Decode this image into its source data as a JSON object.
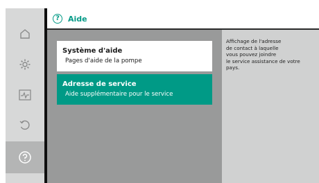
{
  "header": {
    "icon": "help-circle-icon",
    "icon_glyph": "?",
    "title": "Aide",
    "accent": "#079b88"
  },
  "sidebar": {
    "items": [
      {
        "name": "home",
        "icon": "home-icon"
      },
      {
        "name": "settings",
        "icon": "gear-icon"
      },
      {
        "name": "diagnostics",
        "icon": "pulse-monitor-icon"
      },
      {
        "name": "restore",
        "icon": "undo-icon"
      },
      {
        "name": "help",
        "icon": "help-circle-icon",
        "active": true
      }
    ]
  },
  "menu": {
    "items": [
      {
        "title": "Système d'aide",
        "subtitle": "Pages d'aide de la pompe",
        "selected": false
      },
      {
        "title": "Adresse de service",
        "subtitle": "Aide supplémentaire pour le service",
        "selected": true
      }
    ]
  },
  "help_text": {
    "lines": [
      "Affichage de l'adresse",
      "de contact à laquelle",
      "vous pouvez joindre",
      "le service assistance de votre pays."
    ]
  },
  "colors": {
    "selected_bg": "#009a86",
    "panel_bg": "#999a9a",
    "help_bg": "#d0d1d1",
    "rail_bg": "#d7d8d8"
  }
}
